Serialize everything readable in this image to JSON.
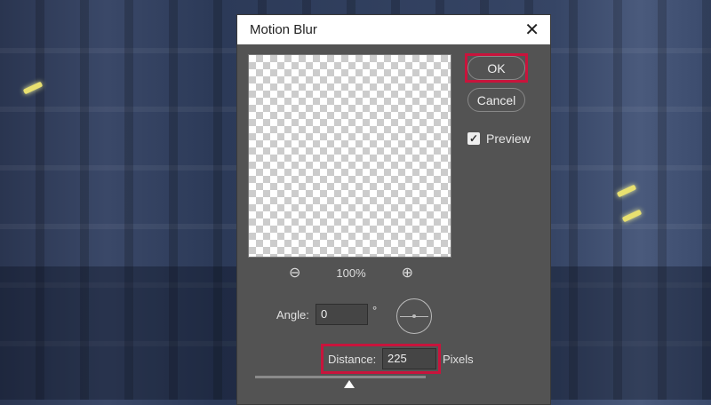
{
  "dialog": {
    "title": "Motion Blur",
    "close_icon": "close-icon"
  },
  "buttons": {
    "ok": "OK",
    "cancel": "Cancel"
  },
  "preview": {
    "label": "Preview",
    "checked": true
  },
  "zoom": {
    "level": "100%"
  },
  "angle": {
    "label": "Angle:",
    "value": "0",
    "unit": "°"
  },
  "distance": {
    "label": "Distance:",
    "value": "225",
    "unit": "Pixels",
    "slider_fraction": 0.55
  },
  "colors": {
    "highlight": "#c8143c",
    "dialog_bg": "#535353"
  }
}
